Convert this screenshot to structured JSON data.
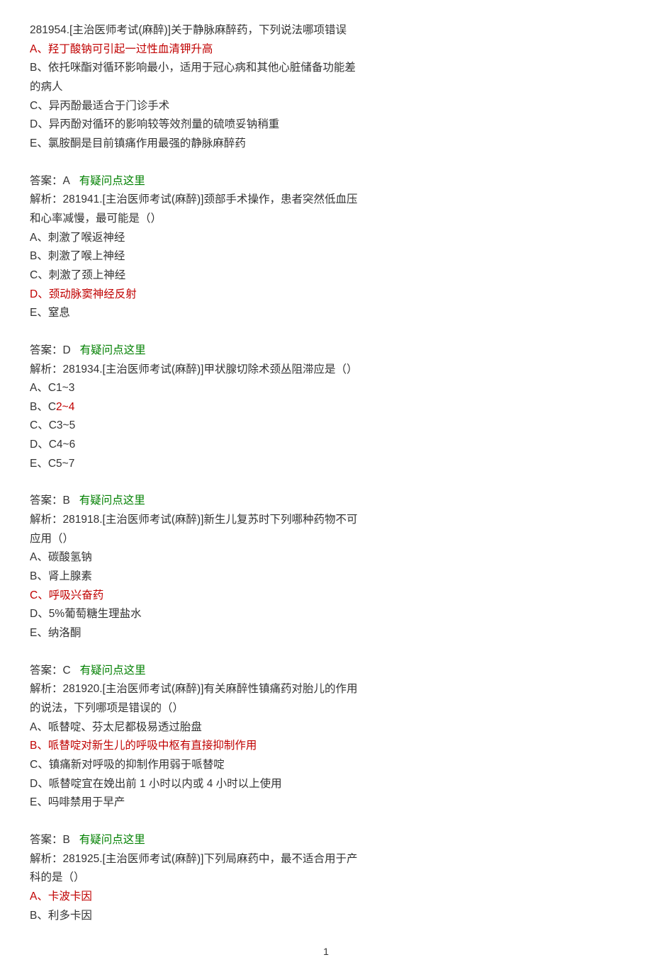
{
  "q1": {
    "title": "281954.[主治医师考试(麻醉)]关于静脉麻醉药，下列说法哪项错误",
    "optA": "A、羟丁酸钠可引起一过性血清钾升高",
    "optB1": "B、依托咪酯对循环影响最小，适用于冠心病和其他心脏储备功能差",
    "optB2": "的病人",
    "optC": "C、异丙酚最适合于门诊手术",
    "optD": "D、异丙酚对循环的影响较等效剂量的硫喷妥钠稍重",
    "optE": "E、氯胺酮是目前镇痛作用最强的静脉麻醉药",
    "ansLabel": "答案：A",
    "link": "有疑问点这里"
  },
  "q2": {
    "expl1": "解析：281941.[主治医师考试(麻醉)]颈部手术操作，患者突然低血压",
    "expl2": "和心率减慢，最可能是（）",
    "optA": "A、刺激了喉返神经",
    "optB": "B、刺激了喉上神经",
    "optC": "C、刺激了颈上神经",
    "optD": "D、颈动脉窦神经反射",
    "optE": "E、窒息",
    "ansLabel": "答案：D",
    "link": "有疑问点这里"
  },
  "q3": {
    "expl": "解析：281934.[主治医师考试(麻醉)]甲状腺切除术颈丛阻滞应是（）",
    "optA_pre": "A、C",
    "optA_sup": "1~3",
    "optB_pre": "B、C",
    "optB_sup": "2~4",
    "optC_pre": "C、C",
    "optC_sup": "3~5",
    "optD_pre": "D、C",
    "optD_sup": "4~6",
    "optE_pre": "E、C",
    "optE_sup": "5~7",
    "ansLabel": "答案：B",
    "link": "有疑问点这里"
  },
  "q4": {
    "expl1": "解析：281918.[主治医师考试(麻醉)]新生儿复苏时下列哪种药物不可",
    "expl2": "应用（）",
    "optA": "A、碳酸氢钠",
    "optB": "B、肾上腺素",
    "optC": "C、呼吸兴奋药",
    "optD": "D、5%葡萄糖生理盐水",
    "optE": "E、纳洛酮",
    "ansLabel": "答案：C",
    "link": "有疑问点这里"
  },
  "q5": {
    "expl1": "解析：281920.[主治医师考试(麻醉)]有关麻醉性镇痛药对胎儿的作用",
    "expl2": "的说法，下列哪项是错误的（）",
    "optA": "A、哌替啶、芬太尼都极易透过胎盘",
    "optB": "B、哌替啶对新生儿的呼吸中枢有直接抑制作用",
    "optC": "C、镇痛新对呼吸的抑制作用弱于哌替啶",
    "optD": "D、哌替啶宜在娩出前 1 小时以内或 4 小时以上使用",
    "optE": "E、吗啡禁用于早产",
    "ansLabel": "答案：B",
    "link": "有疑问点这里"
  },
  "q6": {
    "expl1": "解析：281925.[主治医师考试(麻醉)]下列局麻药中，最不适合用于产",
    "expl2": "科的是（）",
    "optA": "A、卡波卡因",
    "optB": "B、利多卡因"
  },
  "pagenum": "1"
}
